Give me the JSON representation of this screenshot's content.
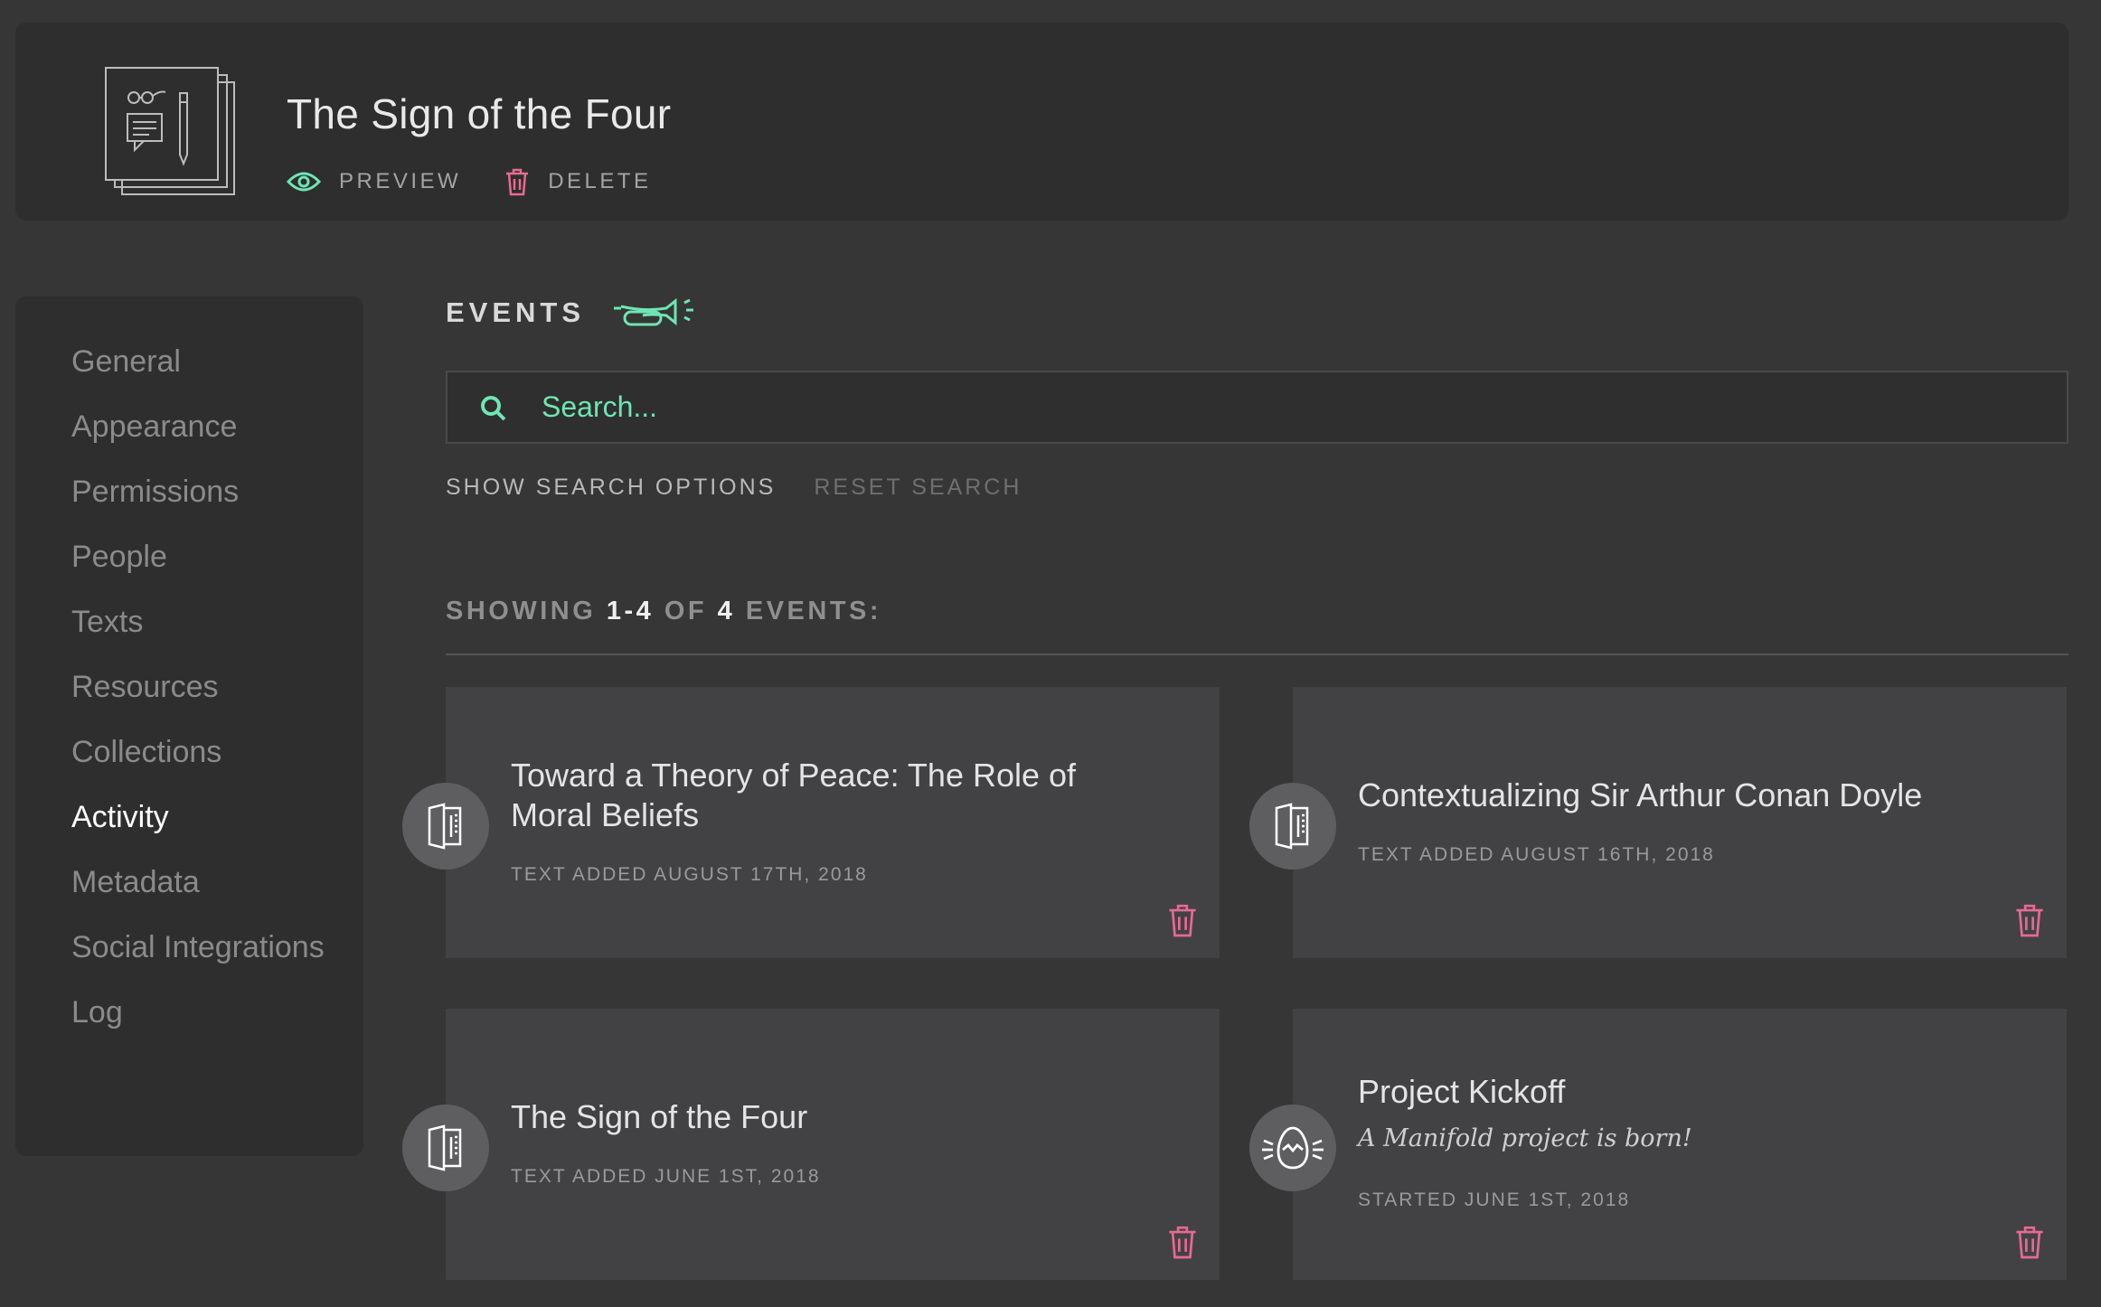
{
  "header": {
    "title": "The Sign of the Four",
    "actions": {
      "preview": "Preview",
      "delete": "Delete"
    }
  },
  "sidebar": {
    "items": [
      {
        "label": "General",
        "active": false
      },
      {
        "label": "Appearance",
        "active": false
      },
      {
        "label": "Permissions",
        "active": false
      },
      {
        "label": "People",
        "active": false
      },
      {
        "label": "Texts",
        "active": false
      },
      {
        "label": "Resources",
        "active": false
      },
      {
        "label": "Collections",
        "active": false
      },
      {
        "label": "Activity",
        "active": true
      },
      {
        "label": "Metadata",
        "active": false
      },
      {
        "label": "Social Integrations",
        "active": false
      },
      {
        "label": "Log",
        "active": false
      }
    ]
  },
  "events": {
    "title": "EVENTS",
    "search_placeholder": "Search...",
    "show_options": "SHOW SEARCH OPTIONS",
    "reset": "RESET SEARCH",
    "showing": {
      "prefix": "SHOWING",
      "range": "1-4",
      "of": "OF",
      "total": "4",
      "suffix": "EVENTS:"
    },
    "cards": [
      {
        "icon": "text-book-icon",
        "title": "Toward a Theory of Peace: The Role of Moral Beliefs",
        "subtitle": "",
        "meta": "TEXT ADDED AUGUST 17TH, 2018"
      },
      {
        "icon": "text-book-icon",
        "title": "Contextualizing Sir Arthur Conan Doyle",
        "subtitle": "",
        "meta": "TEXT ADDED AUGUST 16TH, 2018"
      },
      {
        "icon": "text-book-icon",
        "title": "The Sign of the Four",
        "subtitle": "",
        "meta": "TEXT ADDED JUNE 1ST, 2018"
      },
      {
        "icon": "egg-hatch-icon",
        "title": "Project Kickoff",
        "subtitle": "A Manifold project is born!",
        "meta": "STARTED JUNE 1ST, 2018"
      }
    ]
  },
  "colors": {
    "accent": "#6ee6b3",
    "danger": "#e86a92",
    "background": "#363636",
    "panel": "#2e2e2e",
    "card": "#424244"
  }
}
